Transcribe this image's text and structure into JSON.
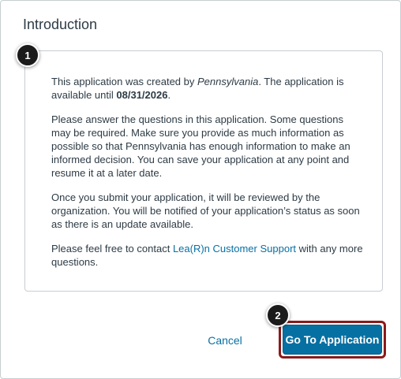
{
  "dialog": {
    "title": "Introduction"
  },
  "content": {
    "p1_prefix": "This application was created by ",
    "p1_creator": "Pennsylvania",
    "p1_middle": ". The application is available until ",
    "p1_date": "08/31/2026",
    "p1_suffix": ".",
    "p2": "Please answer the questions in this application. Some questions may be required. Make sure you provide as much information as possible so that Pennsylvania has enough information to make an informed decision. You can save your application at any point and resume it at a later date.",
    "p3": "Once you submit your application, it will be reviewed by the organization. You will be notified of your application’s status as soon as there is an update available.",
    "p4_prefix": "Please feel free to contact ",
    "p4_link": "Lea(R)n Customer Support",
    "p4_suffix": " with any more questions."
  },
  "callouts": {
    "one": "1",
    "two": "2"
  },
  "actions": {
    "cancel_label": "Cancel",
    "go_label": "Go To Application"
  },
  "colors": {
    "primary": "#0770a3",
    "highlight_outline": "#8b1a1a",
    "badge": "#1b1b1b"
  }
}
